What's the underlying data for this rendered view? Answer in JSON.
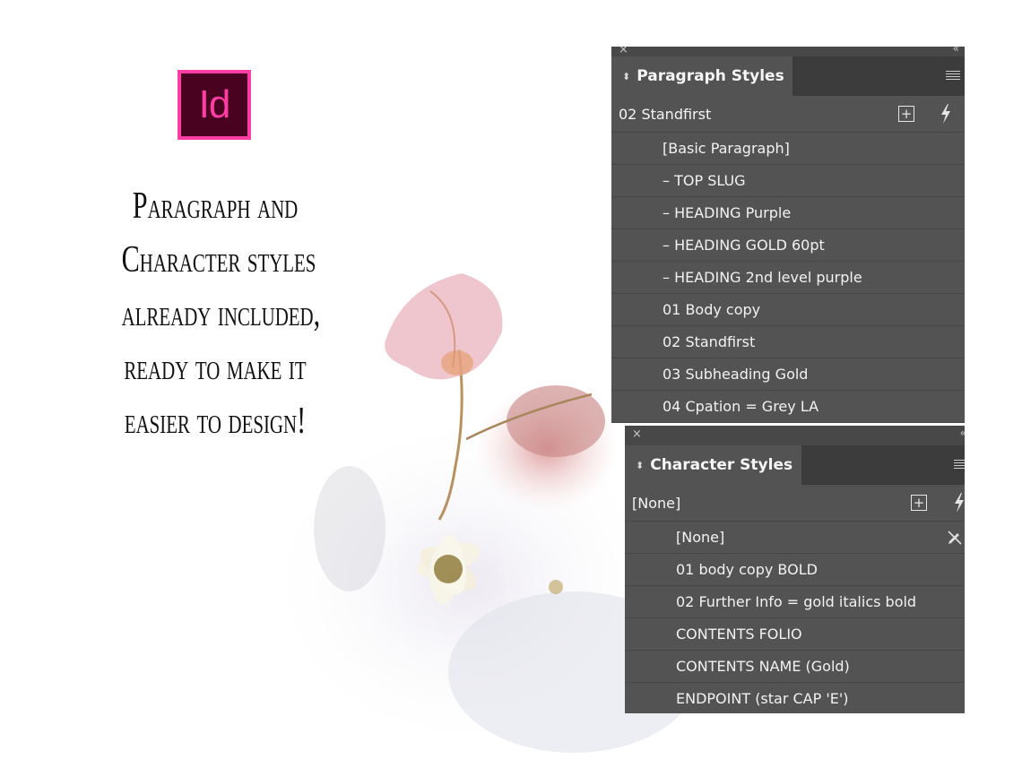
{
  "logo": {
    "text": "Id",
    "border_color": "#ff3ea5",
    "bg_color": "#49021f"
  },
  "headline": {
    "lines": [
      "Paragraph and",
      "Character styles",
      "already included,",
      "ready to make it",
      "easier to design!"
    ]
  },
  "paragraph_panel": {
    "title": "Paragraph Styles",
    "current_style": "02 Standfirst",
    "styles": [
      "[Basic Paragraph]",
      "– TOP SLUG",
      "– HEADING Purple",
      "– HEADING GOLD 60pt",
      "– HEADING 2nd level purple",
      "01 Body copy",
      "02 Standfirst",
      "03 Subheading Gold",
      "04 Cpation = Grey LA"
    ]
  },
  "character_panel": {
    "title": "Character Styles",
    "current_style": "[None]",
    "styles": [
      "[None]",
      "01 body copy BOLD",
      "02 Further Info = gold italics bold",
      "CONTENTS FOLIO",
      "CONTENTS NAME (Gold)",
      "ENDPOINT (star CAP 'E')"
    ]
  },
  "icons": {
    "close": "close-icon",
    "collapse": "collapse-icon",
    "panel_menu": "menu-icon",
    "new_style": "new-style-icon",
    "quick_apply": "lightning-icon",
    "no_edit": "pencil-slash-icon",
    "sort": "up-down-arrows-icon"
  },
  "colors": {
    "panel_bg": "#535353",
    "tab_bar": "#3c3c3c",
    "logo_pink": "#ff3ea5"
  }
}
